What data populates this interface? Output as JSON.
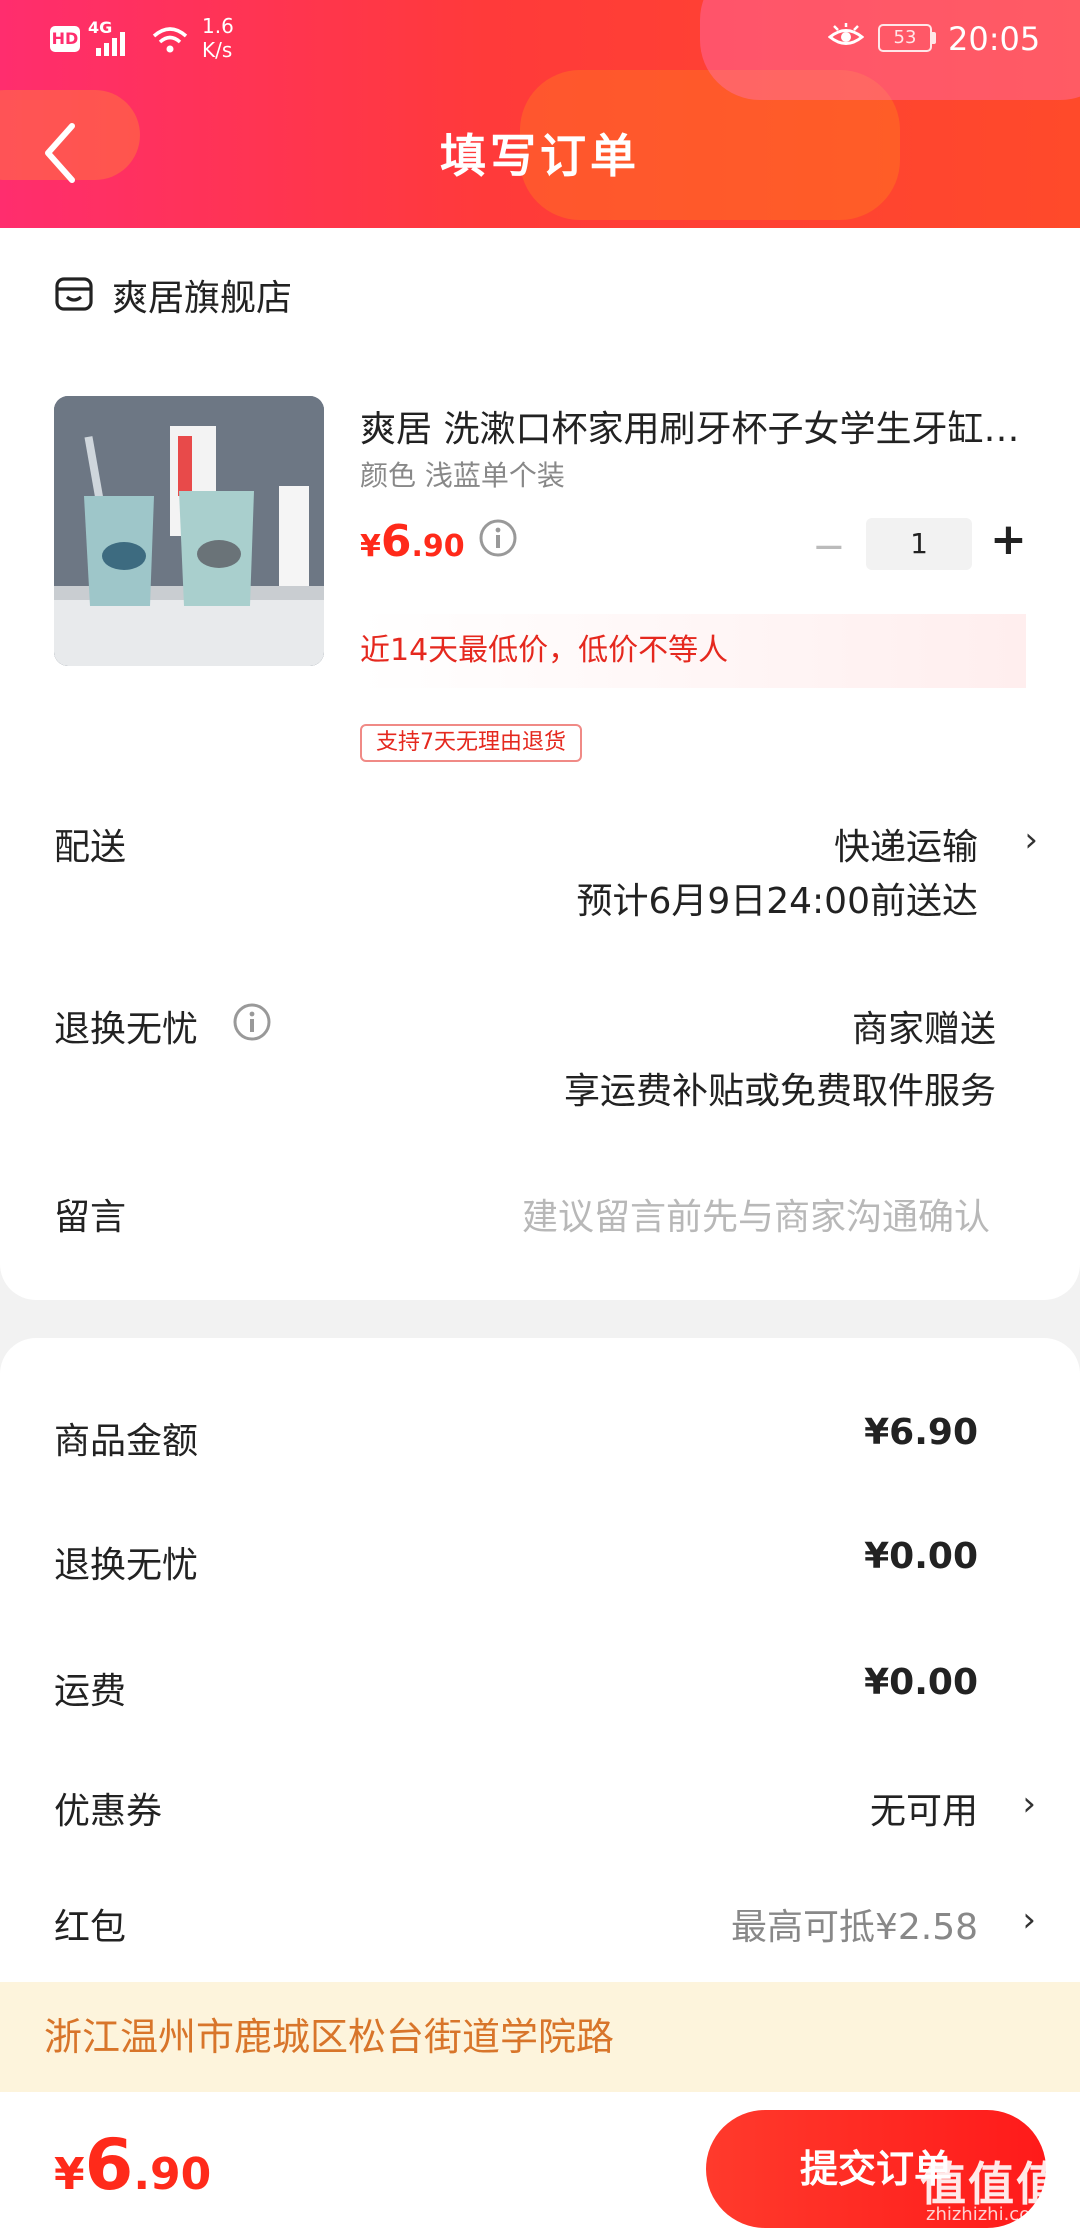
{
  "status_bar": {
    "hd": "HD",
    "network": "4G",
    "speed_value": "1.6",
    "speed_unit": "K/s",
    "battery": "53",
    "time": "20:05"
  },
  "header": {
    "title": "填写订单"
  },
  "store": {
    "name": "爽居旗舰店"
  },
  "product": {
    "name": "爽居 洗漱口杯家用刷牙杯子女学生牙缸情侣一对装",
    "spec": "颜色 浅蓝单个装",
    "price_symbol": "¥",
    "price_int": "6",
    "price_dec": ".90",
    "quantity": "1",
    "minus": "−",
    "plus": "+",
    "low_price_note": "近14天最低价，低价不等人",
    "return_tag": "支持7天无理由退货"
  },
  "delivery": {
    "label": "配送",
    "method": "快递运输",
    "eta": "预计6月9日24:00前送达"
  },
  "return_service": {
    "label": "退换无忧",
    "value": "商家赠送",
    "desc": "享运费补贴或免费取件服务"
  },
  "message": {
    "label": "留言",
    "placeholder": "建议留言前先与商家沟通确认"
  },
  "summary": {
    "goods_label": "商品金额",
    "goods_value": "¥6.90",
    "return_label": "退换无忧",
    "return_value": "¥0.00",
    "shipping_label": "运费",
    "shipping_value": "¥0.00",
    "coupon_label": "优惠券",
    "coupon_value": "无可用",
    "redpacket_label": "红包",
    "redpacket_value": "最高可抵¥2.58"
  },
  "address": {
    "text": "浙江温州市鹿城区松台街道学院路"
  },
  "bottom": {
    "total_symbol": "¥",
    "total_int": "6",
    "total_dec": ".90",
    "submit_label": "提交订单"
  },
  "watermark": {
    "main": "值值值",
    "sub": "zhizhizhi.com"
  },
  "colors": {
    "accent": "#ff2a1a",
    "header_start": "#ff2d6e",
    "header_end": "#ff4a2a",
    "address_bg": "#fdf4dc",
    "address_text": "#d8752a"
  }
}
